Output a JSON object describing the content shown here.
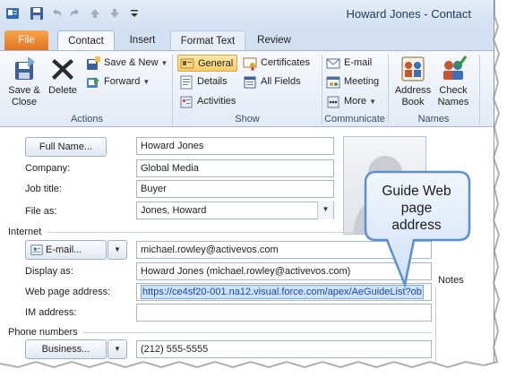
{
  "window": {
    "title": "Howard Jones  -  Contact"
  },
  "tabs": [
    {
      "label": "File"
    },
    {
      "label": "Contact"
    },
    {
      "label": "Insert"
    },
    {
      "label": "Format Text"
    },
    {
      "label": "Review"
    }
  ],
  "ribbon": {
    "groups": {
      "actions": "Actions",
      "show": "Show",
      "communicate": "Communicate",
      "names": "Names"
    },
    "save_close": {
      "line1": "Save &",
      "line2": "Close"
    },
    "delete": "Delete",
    "save_new": "Save & New",
    "forward": "Forward",
    "general": "General",
    "details": "Details",
    "activities": "Activities",
    "certificates": "Certificates",
    "all_fields": "All Fields",
    "email": "E-mail",
    "meeting": "Meeting",
    "more": "More",
    "address_book": {
      "line1": "Address",
      "line2": "Book"
    },
    "check_names": {
      "line1": "Check",
      "line2": "Names"
    }
  },
  "form": {
    "full_name_button": "Full Name...",
    "full_name": "Howard Jones",
    "company_label": "Company:",
    "company": "Global Media",
    "job_title_label": "Job title:",
    "job_title": "Buyer",
    "file_as_label": "File as:",
    "file_as": "Jones, Howard",
    "internet_section": "Internet",
    "email_button": "E-mail...",
    "email": "michael.rowley@activevos.com",
    "display_as_label": "Display as:",
    "display_as": "Howard Jones (michael.rowley@activevos.com)",
    "web_page_label": "Web page address:",
    "web_page": "https://ce4sf20-001.na12.visual.force.com/apex/AeGuideList?ob",
    "im_label": "IM address:",
    "im": "",
    "phone_section": "Phone numbers",
    "business_button": "Business...",
    "business_phone": "(212) 555-5555",
    "notes_label": "Notes"
  },
  "callout": {
    "text_line1": "Guide Web",
    "text_line2": "page",
    "text_line3": "address"
  },
  "colors": {
    "file_tab": "#e3721f",
    "ribbon_selected": "#f8cd6a",
    "link": "#1a46b8",
    "callout_fill": "#e0edfb",
    "callout_border": "#5b8fd3"
  }
}
